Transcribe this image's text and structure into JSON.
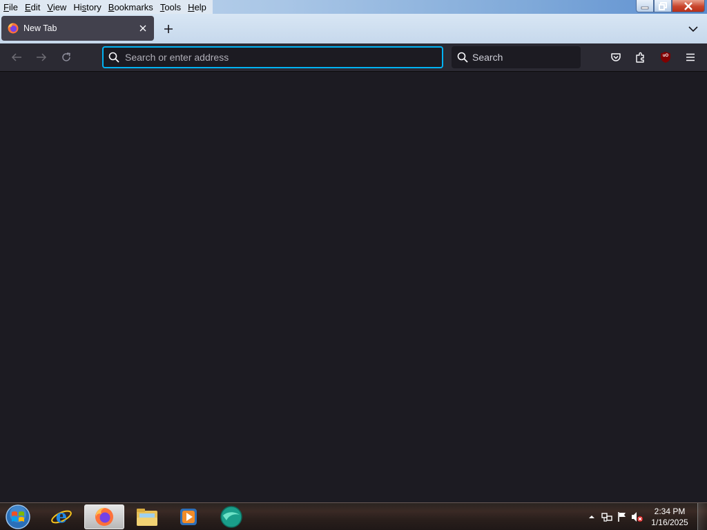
{
  "menubar": {
    "items": [
      {
        "mnemonic": "F",
        "rest": "ile"
      },
      {
        "mnemonic": "E",
        "rest": "dit"
      },
      {
        "mnemonic": "V",
        "rest": "iew"
      },
      {
        "mnemonic": "",
        "rest": "Hi",
        "mnemonic2": "s",
        "rest2": "tory"
      },
      {
        "mnemonic": "B",
        "rest": "ookmarks"
      },
      {
        "mnemonic": "T",
        "rest": "ools"
      },
      {
        "mnemonic": "H",
        "rest": "elp"
      }
    ]
  },
  "tabs": [
    {
      "title": "New Tab",
      "icon": "firefox-icon",
      "active": true
    }
  ],
  "urlbar": {
    "placeholder": "Search or enter address",
    "value": ""
  },
  "searchbar": {
    "placeholder": "Search",
    "value": ""
  },
  "toolbar_icons": [
    "pocket-icon",
    "extensions-icon",
    "ublock-origin-icon",
    "hamburger-menu-icon"
  ],
  "ublock_label": "uO",
  "taskbar": {
    "pinned": [
      "internet-explorer-icon",
      "firefox-icon",
      "file-explorer-icon",
      "media-player-icon",
      "network-globe-icon"
    ],
    "active": "firefox-icon"
  },
  "clock": {
    "time": "2:34 PM",
    "date": "1/16/2025"
  },
  "colors": {
    "accent": "#00b3f4",
    "toolbar": "#2b2a33",
    "content": "#1c1b22",
    "tab": "#42414d"
  }
}
